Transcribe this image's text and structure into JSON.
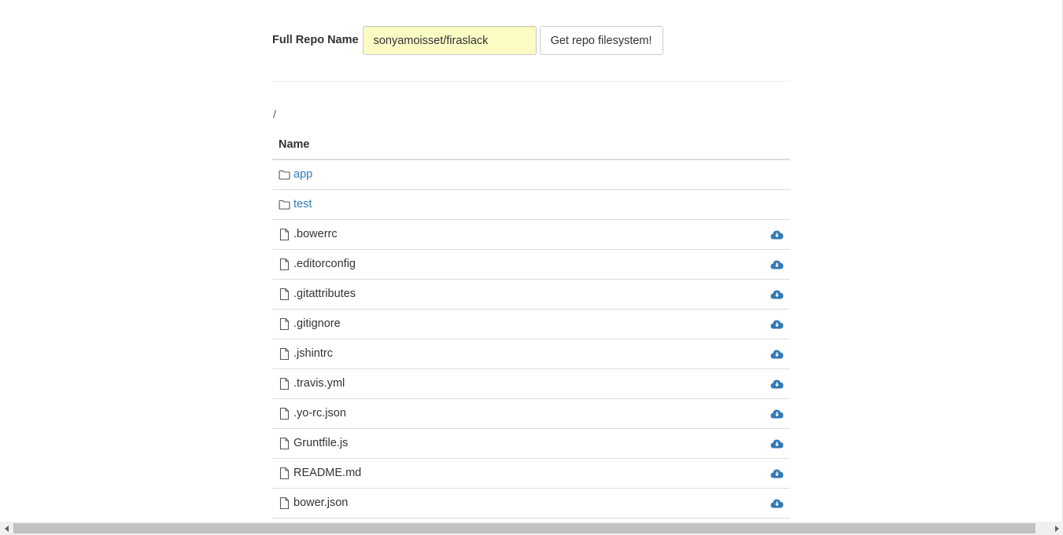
{
  "form": {
    "label": "Full Repo Name",
    "input_value": "sonyamoisset/firaslack",
    "button_label": "Get repo filesystem!"
  },
  "path": "/",
  "table": {
    "header": "Name",
    "folders": [
      {
        "name": "app",
        "icon": "folder-icon"
      },
      {
        "name": "test",
        "icon": "folder-icon"
      }
    ],
    "files": [
      {
        "name": ".bowerrc",
        "icon": "file-icon"
      },
      {
        "name": ".editorconfig",
        "icon": "file-icon"
      },
      {
        "name": ".gitattributes",
        "icon": "file-icon"
      },
      {
        "name": ".gitignore",
        "icon": "file-icon"
      },
      {
        "name": ".jshintrc",
        "icon": "file-icon"
      },
      {
        "name": ".travis.yml",
        "icon": "file-icon"
      },
      {
        "name": ".yo-rc.json",
        "icon": "file-icon"
      },
      {
        "name": "Gruntfile.js",
        "icon": "file-icon"
      },
      {
        "name": "README.md",
        "icon": "file-icon"
      },
      {
        "name": "bower.json",
        "icon": "file-icon"
      }
    ]
  },
  "colors": {
    "link": "#337ab7",
    "input_bg": "#fafcc4",
    "download_icon": "#337ab7"
  }
}
